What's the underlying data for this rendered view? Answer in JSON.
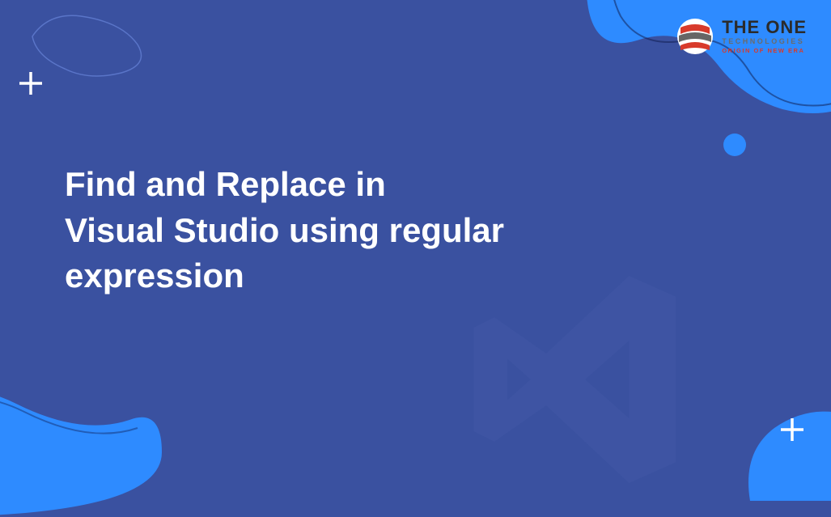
{
  "title_line1": "Find and Replace in",
  "title_line2": "Visual Studio using regular",
  "title_line3": "expression",
  "logo": {
    "main": "THE ONE",
    "sub": "TECHNOLOGIES",
    "tagline": "ORIGIN OF NEW ERA"
  },
  "colors": {
    "background": "#3a51a0",
    "accent_blue": "#2e8bff",
    "text": "#ffffff"
  }
}
